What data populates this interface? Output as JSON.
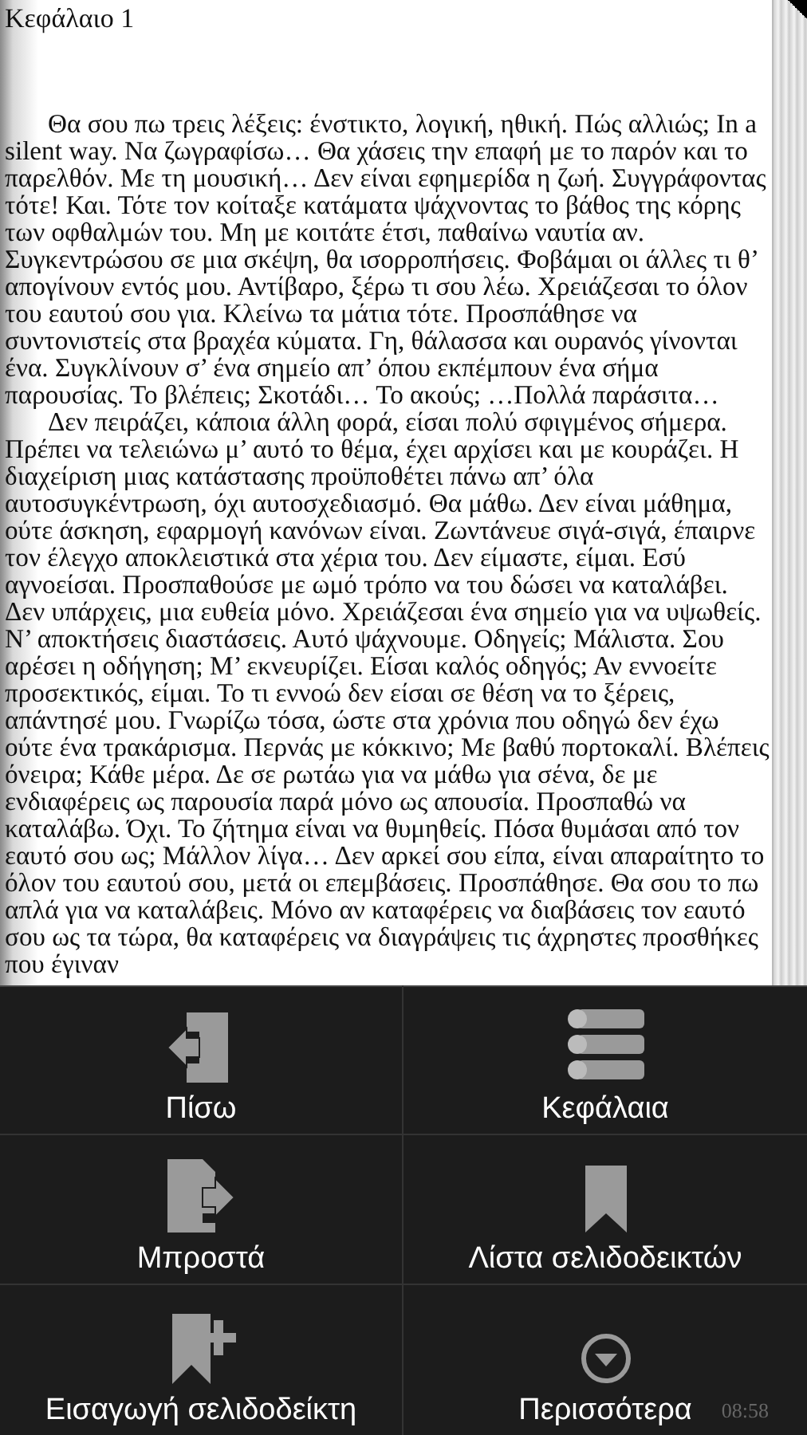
{
  "chapter_title": "Κεφάλαιο 1",
  "paragraphs": [
    "Θα σου πω τρεις λέξεις: ένστικτο, λογική, ηθική. Πώς αλλιώς; In a silent way. Να ζωγραφίσω… Θα χάσεις την επαφή με το παρόν και το παρελθόν. Με τη μουσική… Δεν είναι εφημερίδα η ζωή. Συγγράφοντας τότε! Και. Τότε τον κοίταξε κατάματα ψάχνοντας το βάθος της κόρης των οφθαλμών του. Μη με κοιτάτε έτσι, παθαίνω ναυτία αν. Συγκεντρώσου σε μια σκέψη, θα ισορροπήσεις. Φοβάμαι οι άλλες τι θ’ απογίνουν εντός μου. Αντίβαρο, ξέρω τι σου λέω. Χρειάζεσαι το όλον του εαυτού σου για. Κλείνω τα μάτια τότε. Προσπάθησε να συντονιστείς στα βραχέα κύματα. Γη, θάλασσα και ουρανός γίνονται ένα. Συγκλίνουν σ’ ένα σημείο απ’ όπου εκπέμπουν ένα σήμα παρουσίας. Το βλέπεις; Σκοτάδι… Το ακούς; …Πολλά παράσιτα…",
    "Δεν πειράζει, κάποια άλλη φορά, είσαι πολύ σφιγμένος σήμερα. Πρέπει να τελειώνω μ’ αυτό το θέμα, έχει αρχίσει και με κουράζει. Η διαχείριση μιας κατάστασης προϋποθέτει πάνω απ’ όλα αυτοσυγκέντρωση, όχι αυτοσχεδιασμό. Θα μάθω. Δεν είναι μάθημα, ούτε άσκηση, εφαρμογή κανόνων είναι. Ζωντάνευε σιγά-σιγά, έπαιρνε τον έλεγχο αποκλειστικά στα χέρια του. Δεν είμαστε, είμαι. Εσύ αγνοείσαι. Προσπαθούσε με ωμό τρόπο να του δώσει να καταλάβει. Δεν υπάρχεις, μια ευθεία μόνο. Χρειάζεσαι ένα σημείο για να υψωθείς. Ν’ αποκτήσεις διαστάσεις. Αυτό ψάχνουμε. Οδηγείς; Μάλιστα. Σου αρέσει η οδήγηση; Μ’ εκνευρίζει. Είσαι καλός οδηγός; Αν εννοείτε προσεκτικός, είμαι. Το τι εννοώ δεν είσαι σε θέση να το ξέρεις, απάντησέ μου. Γνωρίζω τόσα, ώστε στα χρόνια που οδηγώ δεν έχω ούτε ένα τρακάρισμα. Περνάς με κόκκινο; Με βαθύ πορτοκαλί. Βλέπεις όνειρα; Κάθε μέρα. Δε σε ρωτάω για να μάθω για σένα, δε με ενδιαφέρεις ως παρουσία παρά μόνο ως απουσία. Προσπαθώ να καταλάβω. Όχι. Το ζήτημα είναι να θυμηθείς. Πόσα θυμάσαι από τον εαυτό σου ως; Μάλλον λίγα… Δεν αρκεί σου είπα, είναι απαραίτητο το όλον του εαυτού σου, μετά οι επεμβάσεις. Προσπάθησε. Θα σου το πω απλά για να καταλάβεις. Μόνο αν καταφέρεις να διαβάσεις τον εαυτό σου ως τα τώρα, θα καταφέρεις να διαγράψεις τις άχρηστες προσθήκες που έγιναν"
  ],
  "menu": {
    "items": [
      {
        "kind": "back",
        "label": "Πίσω"
      },
      {
        "kind": "chapters",
        "label": "Κεφάλαια"
      },
      {
        "kind": "forward",
        "label": "Μπροστά"
      },
      {
        "kind": "bookmarks",
        "label": "Λίστα σελιδοδεικτών"
      },
      {
        "kind": "add_bookmark",
        "label": "Εισαγωγή σελιδοδείκτη"
      },
      {
        "kind": "more",
        "label": "Περισσότερα"
      }
    ]
  },
  "clock": "08:58"
}
